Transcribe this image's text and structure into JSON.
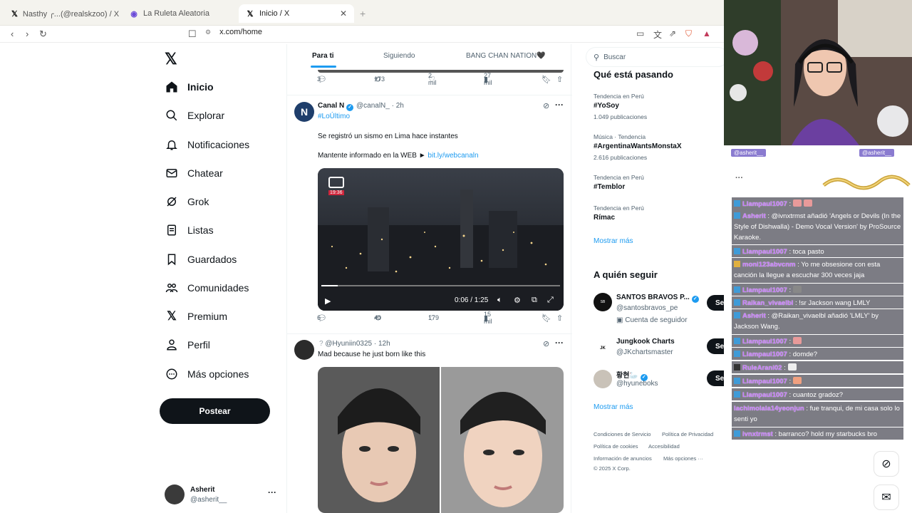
{
  "browser": {
    "tabs": [
      {
        "label": "Nasthy ╭...(@realskzoo) / X",
        "icon": "x-icon"
      },
      {
        "label": "La Ruleta Aleatoria",
        "icon": "wheel-icon"
      },
      {
        "label": "Inicio / X",
        "icon": "x-icon"
      }
    ],
    "url": "x.com/home",
    "new_tab": "+"
  },
  "nav": {
    "items": [
      {
        "label": "Inicio",
        "icon": "home-icon"
      },
      {
        "label": "Explorar",
        "icon": "search-icon"
      },
      {
        "label": "Notificaciones",
        "icon": "bell-icon"
      },
      {
        "label": "Chatear",
        "icon": "mail-icon"
      },
      {
        "label": "Grok",
        "icon": "grok-icon"
      },
      {
        "label": "Listas",
        "icon": "list-icon"
      },
      {
        "label": "Guardados",
        "icon": "bookmark-icon"
      },
      {
        "label": "Comunidades",
        "icon": "people-icon"
      },
      {
        "label": "Premium",
        "icon": "x-icon"
      },
      {
        "label": "Perfil",
        "icon": "person-icon"
      },
      {
        "label": "Más opciones",
        "icon": "more-circle-icon"
      }
    ],
    "post_label": "Postear",
    "account": {
      "name": "Asherit",
      "handle": "@asherit__",
      "more": "···"
    }
  },
  "feed": {
    "tabs": [
      "Para ti",
      "Siguiendo",
      "BANG CHAN NATION🖤"
    ],
    "prev_actions": {
      "replies": "3",
      "reposts": "173",
      "likes": "2 mil",
      "views": "27 mil"
    },
    "tweet1": {
      "name": "Canal N",
      "handle": "@canalN_",
      "time": "· 2h",
      "tag": "#LoÚltimo",
      "line1": "Se registró un sismo en Lima hace instantes",
      "line2_prefix": "Mantente informado en la WEB ►",
      "line2_link": "bit.ly/webcanaln",
      "video": {
        "badge": "19:36",
        "time_display": "0:06 / 1:25",
        "progress": 0.07
      },
      "actions": {
        "replies": "6",
        "reposts": "40",
        "likes": "179",
        "views": "15 mil"
      }
    },
    "tweet2": {
      "handle": "@Hyuniin0325",
      "time": "· 12h",
      "text": "Mad because he just born like this"
    }
  },
  "sidebar": {
    "search_placeholder": "Buscar",
    "trends_title": "Qué está pasando",
    "trends": [
      {
        "meta": "Tendencia en Perú",
        "name": "#YoSoy",
        "count": "1.049 publicaciones"
      },
      {
        "meta": "Música · Tendencia",
        "name": "#ArgentinaWantsMonstaX",
        "count": "2.616 publicaciones"
      },
      {
        "meta": "Tendencia en Perú",
        "name": "#Temblor",
        "count": ""
      },
      {
        "meta": "Tendencia en Perú",
        "name": "Rímac",
        "count": ""
      }
    ],
    "show_more": "Mostrar más",
    "follow_title": "A quién seguir",
    "follow": [
      {
        "name": "SANTOS BRAVOS P...",
        "handle": "@santosbravos_pe",
        "extra": "Cuenta de seguidor",
        "button": "Seguir"
      },
      {
        "name": "Jungkook Charts",
        "handle": "@JKchartsmaster",
        "extra": "",
        "button": "Seguir"
      },
      {
        "name": "황현🦢",
        "handle": "@hyuneboks",
        "extra": "",
        "button": "Seguir"
      }
    ],
    "show_more2": "Mostrar más",
    "footer": [
      "Condiciones de Servicio",
      "Política de Privacidad",
      "Política de cookies",
      "Accesibilidad",
      "Información de anuncios",
      "Más opciones ···",
      "© 2025 X Corp."
    ]
  },
  "stream": {
    "webcam_labels": [
      "@asherit__",
      "@asherit__"
    ],
    "chat": [
      {
        "user": "Llampaul1007",
        "text": ":"
      },
      {
        "user": "Asherit",
        "text": ": @ivnxtrmst añadió 'Angels or Devils (In the Style of Dishwalla) - Demo Vocal Version' by ProSource Karaoke."
      },
      {
        "user": "Llampaul1007",
        "text": ": toca pasto"
      },
      {
        "user": "moni123abvcnm",
        "text": ": Yo me obsesione con esta canción la llegue a escuchar 300 veces jaja"
      },
      {
        "user": "Llampaul1007",
        "text": ":"
      },
      {
        "user": "Raikan_vivaelbl",
        "text": ": !sr Jackson wang LMLY"
      },
      {
        "user": "Asherit",
        "text": ": @Raikan_vivaelbl añadió 'LMLY' by Jackson Wang."
      },
      {
        "user": "Llampaul1007",
        "text": ":"
      },
      {
        "user": "Llampaul1007",
        "text": ": domde?"
      },
      {
        "user": "RuleArani02",
        "text": ":"
      },
      {
        "user": "Llampaul1007",
        "text": ":"
      },
      {
        "user": "Llampaul1007",
        "text": ": cuantoz gradoz?"
      },
      {
        "user": "lachimolala14yeonjun",
        "text": ": fue tranqui, de mi casa solo lo senti yo"
      },
      {
        "user": "ivnxtrmst",
        "text": ": barranco? hold my starbucks bro"
      }
    ]
  },
  "colors": {
    "accent": "#1d9bf0",
    "text": "#0f1419",
    "muted": "#536471",
    "chat_user": "#c879ff"
  }
}
